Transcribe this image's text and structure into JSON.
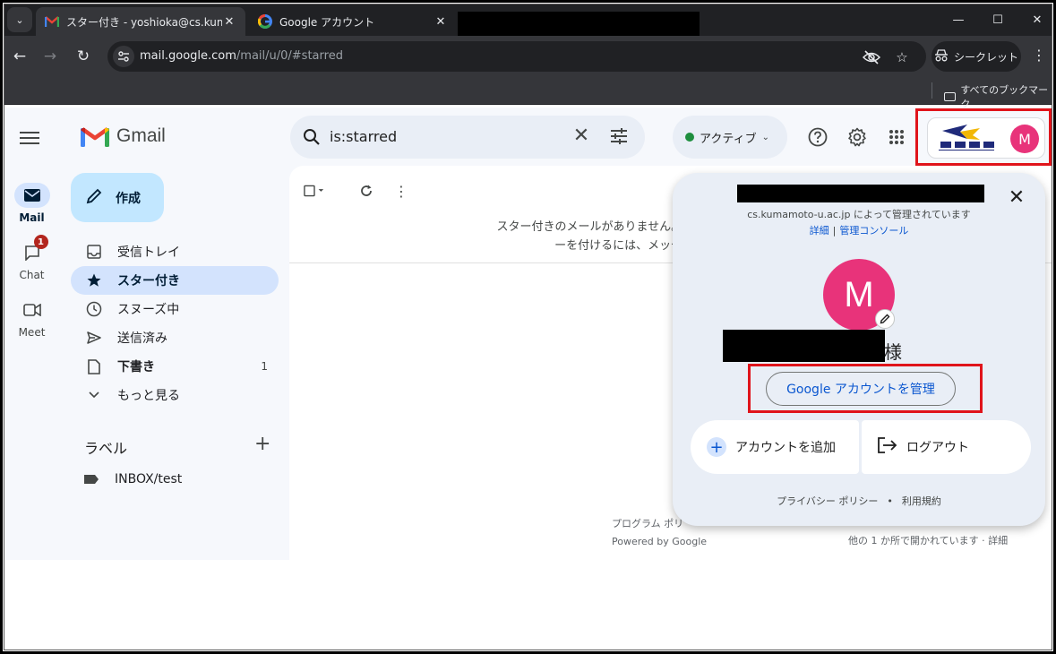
{
  "browser": {
    "tabs": [
      {
        "title": "スター付き - yoshioka@cs.kumam",
        "favicon": "gmail-favicon",
        "active": true
      },
      {
        "title": "Google アカウント",
        "favicon": "google-favicon",
        "active": false
      }
    ],
    "address": {
      "host": "mail.google.com",
      "path": "/mail/u/0/#starred"
    },
    "incognito_label": "シークレット",
    "bookmarks_all_label": "すべてのブックマーク",
    "window_controls": {
      "minimize": "—",
      "maximize": "☐",
      "close": "✕"
    }
  },
  "gmail": {
    "logo_text": "Gmail",
    "rail": [
      {
        "label": "Mail",
        "icon": "mail-icon",
        "active": true
      },
      {
        "label": "Chat",
        "icon": "chat-icon",
        "badge": "1"
      },
      {
        "label": "Meet",
        "icon": "video-icon"
      }
    ],
    "compose_label": "作成",
    "nav": [
      {
        "label": "受信トレイ",
        "icon": "inbox-icon"
      },
      {
        "label": "スター付き",
        "icon": "star-icon",
        "active": true
      },
      {
        "label": "スヌーズ中",
        "icon": "clock-icon"
      },
      {
        "label": "送信済み",
        "icon": "send-icon"
      },
      {
        "label": "下書き",
        "icon": "draft-icon",
        "count": "1"
      },
      {
        "label": "もっと見る",
        "icon": "chevron-down-icon"
      }
    ],
    "labels_heading": "ラベル",
    "labels": [
      {
        "name": "INBOX/test"
      }
    ],
    "search": {
      "value": "is:starred"
    },
    "status_label": "アクティブ",
    "empty_message_line1": "スター付きのメールがありません。スターを使って特別なメールを",
    "empty_message_line2": "ーを付けるには、メッセージやスレッドの横",
    "footer_left_line1": "プログラム ポリ",
    "footer_left_line2": "Powered by Google",
    "footer_right": "他の 1 か所で開かれています · 詳細"
  },
  "account_popup": {
    "managed_by": "cs.kumamoto-u.ac.jp によって管理されています",
    "link_details": "詳細",
    "link_console": "管理コンソール",
    "avatar_letter": "M",
    "name_suffix": "様",
    "manage_button": "Google アカウントを管理",
    "add_account": "アカウントを追加",
    "logout": "ログアウト",
    "privacy": "プライバシー ポリシー",
    "terms": "利用規約",
    "dot": "•"
  },
  "avatar_small_letter": "M",
  "colors": {
    "accent_blue": "#0b57d0",
    "avatar_pink": "#e8337a",
    "highlight_red": "#e0141b",
    "active_nav": "#d3e3fd"
  }
}
